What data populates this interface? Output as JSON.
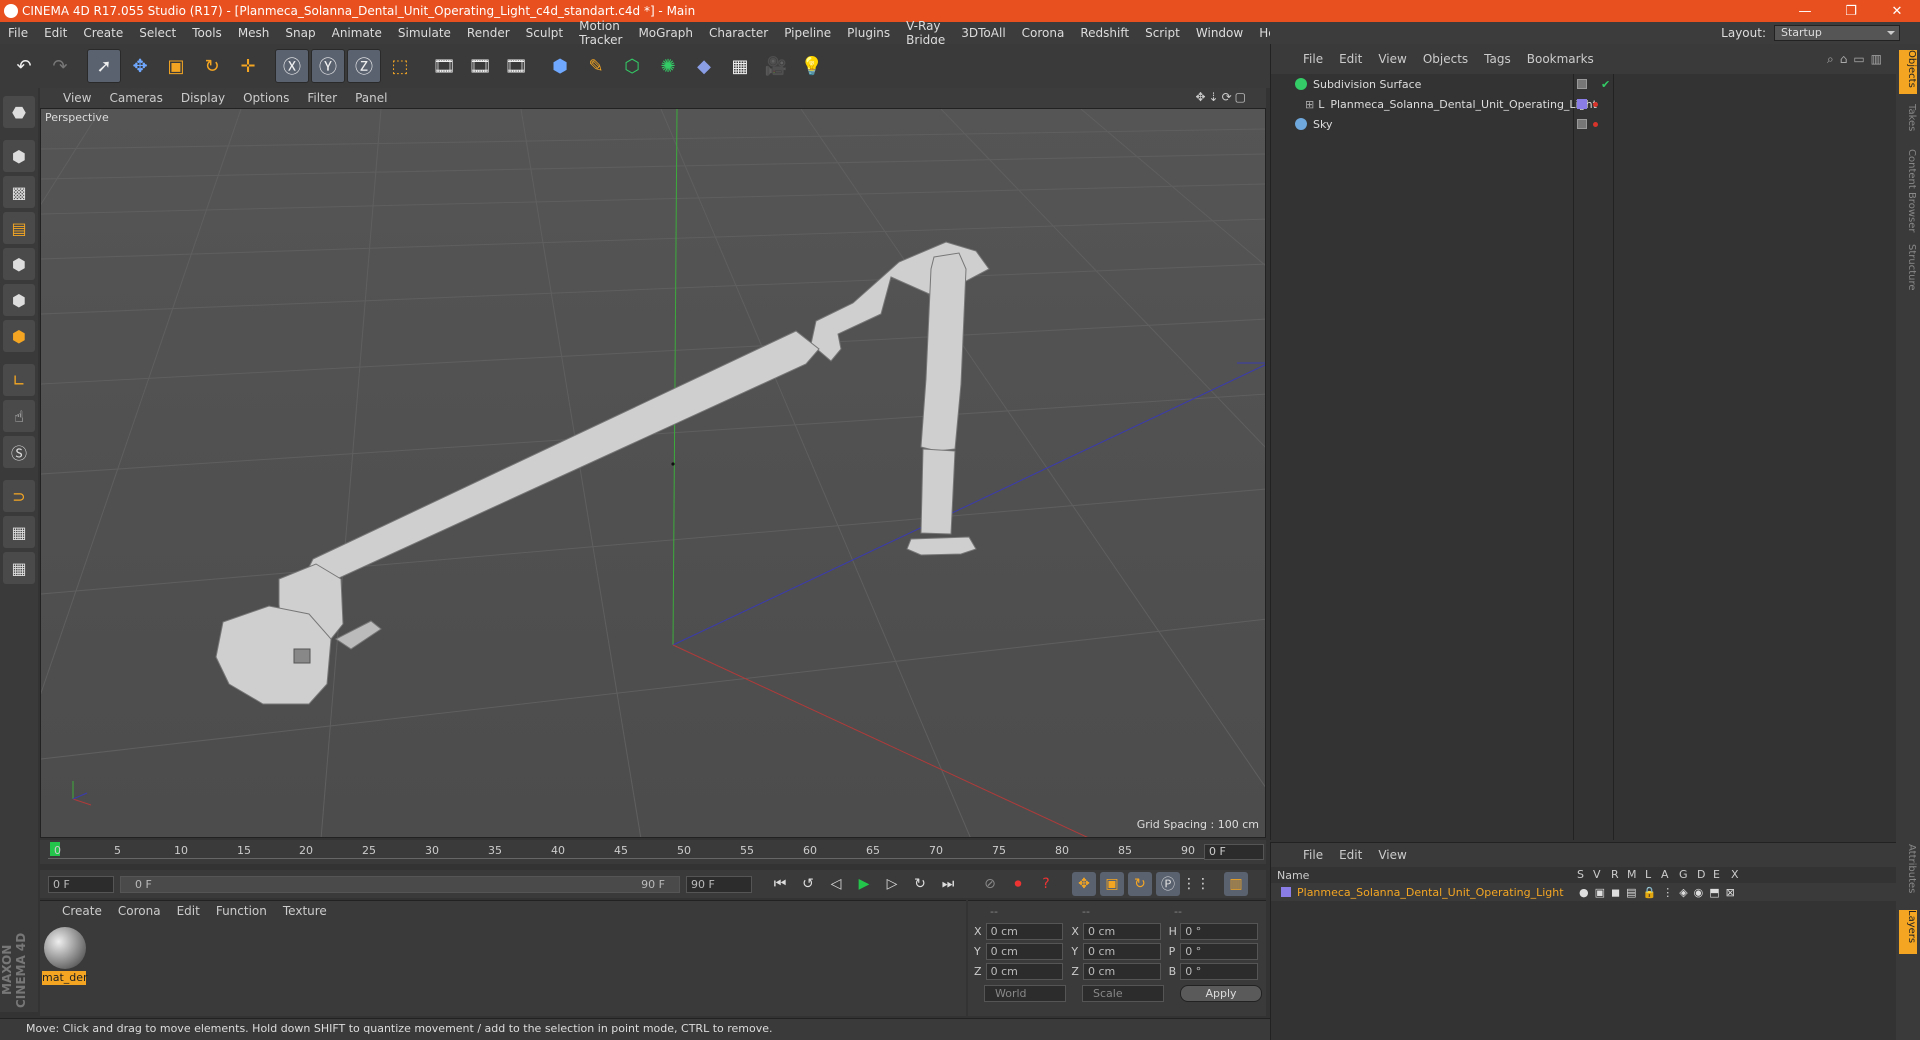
{
  "window": {
    "title": "CINEMA 4D R17.055 Studio (R17) - [Planmeca_Solanna_Dental_Unit_Operating_Light_c4d_standart.c4d *] - Main"
  },
  "menubar": [
    "File",
    "Edit",
    "Create",
    "Select",
    "Tools",
    "Mesh",
    "Snap",
    "Animate",
    "Simulate",
    "Render",
    "Sculpt",
    "Motion Tracker",
    "MoGraph",
    "Character",
    "Pipeline",
    "Plugins",
    "V-Ray Bridge",
    "3DToAll",
    "Corona",
    "Redshift",
    "Script",
    "Window",
    "Help"
  ],
  "layout": {
    "label": "Layout:",
    "value": "Startup"
  },
  "viewport": {
    "menu": [
      "View",
      "Cameras",
      "Display",
      "Options",
      "Filter",
      "Panel"
    ],
    "label": "Perspective",
    "grid_spacing": "Grid Spacing : 100 cm"
  },
  "timeline": {
    "ticks": [
      "0",
      "5",
      "10",
      "15",
      "20",
      "25",
      "30",
      "35",
      "40",
      "45",
      "50",
      "55",
      "60",
      "65",
      "70",
      "75",
      "80",
      "85",
      "90"
    ],
    "frame_field": "0 F"
  },
  "transport": {
    "start": "0 F",
    "range_start": "0 F",
    "range_end": "90 F",
    "end": "90 F"
  },
  "materials": {
    "menu": [
      "Create",
      "Corona",
      "Edit",
      "Function",
      "Texture"
    ],
    "items": [
      {
        "name": "mat_der"
      }
    ]
  },
  "coords": {
    "headers": [
      "--",
      "--",
      "--"
    ],
    "rows": [
      {
        "a": "X",
        "v1": "0 cm",
        "b": "X",
        "v2": "0 cm",
        "c": "H",
        "v3": "0 °"
      },
      {
        "a": "Y",
        "v1": "0 cm",
        "b": "Y",
        "v2": "0 cm",
        "c": "P",
        "v3": "0 °"
      },
      {
        "a": "Z",
        "v1": "0 cm",
        "b": "Z",
        "v2": "0 cm",
        "c": "B",
        "v3": "0 °"
      }
    ],
    "space": "World",
    "mode": "Scale",
    "apply": "Apply"
  },
  "status": "Move: Click and drag to move elements. Hold down SHIFT to quantize movement / add to the selection in point mode, CTRL to remove.",
  "objects": {
    "menu": [
      "File",
      "Edit",
      "View",
      "Objects",
      "Tags",
      "Bookmarks"
    ],
    "items": [
      {
        "name": "Subdivision Surface",
        "icon_color": "#33cc66"
      },
      {
        "name": "Planmeca_Solanna_Dental_Unit_Operating_Light",
        "icon_color": "#aaaaaa"
      },
      {
        "name": "Sky",
        "icon_color": "#6fa8dc"
      }
    ]
  },
  "layers": {
    "menu": [
      "File",
      "Edit",
      "View"
    ],
    "headers": {
      "name": "Name",
      "cols": [
        "S",
        "V",
        "R",
        "M",
        "L",
        "A",
        "G",
        "D",
        "E",
        "X"
      ]
    },
    "items": [
      {
        "name": "Planmeca_Solanna_Dental_Unit_Operating_Light",
        "color": "#8a7ee6"
      }
    ]
  },
  "side_tabs": [
    "Objects",
    "Takes",
    "Content Browser",
    "Structure"
  ],
  "side_tabs_bottom": [
    "Attributes",
    "Layers"
  ],
  "brand": "MAXON CINEMA 4D"
}
